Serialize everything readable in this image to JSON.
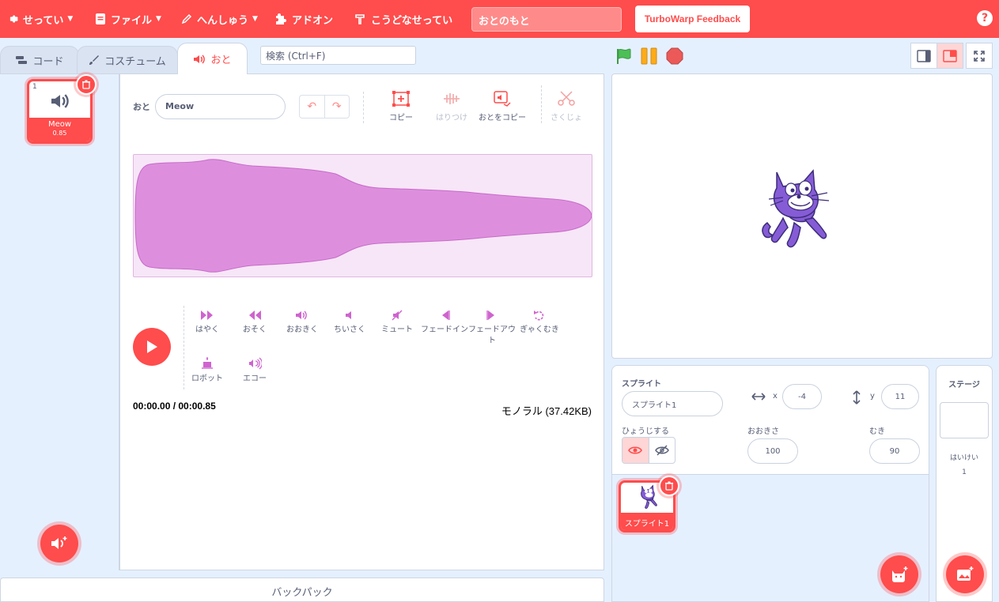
{
  "menubar": {
    "settings": "せってい",
    "file": "ファイル",
    "edit": "へんしゅう",
    "addons": "アドオン",
    "tutorials": "こうどなせってい",
    "project_title": "おとのもと",
    "feedback": "TurboWarp Feedback",
    "help": "?"
  },
  "tabs": {
    "code": "コード",
    "costumes": "コスチューム",
    "sounds": "おと"
  },
  "search": {
    "placeholder": "検索 (Ctrl+F)"
  },
  "sound_list": {
    "items": [
      {
        "number": "1",
        "name": "Meow",
        "duration": "0.85"
      }
    ]
  },
  "editor": {
    "name_label": "おと",
    "name_value": "Meow",
    "tools": {
      "copy": "コピー",
      "paste": "はりつけ",
      "copy_to_new": "おとをコピー",
      "delete": "さくじょ"
    },
    "effects": {
      "faster": "はやく",
      "slower": "おそく",
      "louder": "おおきく",
      "softer": "ちいさく",
      "mute": "ミュート",
      "fade_in": "フェードイン",
      "fade_out_line1": "フェードアウ",
      "fade_out_line2": "ト",
      "reverse": "ぎゃくむき",
      "robot": "ロボット",
      "echo": "エコー"
    },
    "time": "00:00.00 / 00:00.85",
    "format": "モノラル (37.42KB)"
  },
  "backpack": {
    "label": "バックパック"
  },
  "sprite_info": {
    "sprite_label": "スプライト",
    "sprite_name": "スプライト1",
    "x_label": "x",
    "x_value": "-4",
    "y_label": "y",
    "y_value": "11",
    "show_label": "ひょうじする",
    "size_label": "おおきさ",
    "size_value": "100",
    "direction_label": "むき",
    "direction_value": "90"
  },
  "sprites": [
    {
      "name": "スプライト1"
    }
  ],
  "stage_panel": {
    "title": "ステージ",
    "backdrops_label": "はいけい",
    "backdrops_count": "1"
  },
  "colors": {
    "brand": "#ff4c4c",
    "sound_wave": "#d98ddb",
    "sound_accent": "#cf63cf",
    "flag": "#4cbf56",
    "pause": "#ffab19"
  }
}
